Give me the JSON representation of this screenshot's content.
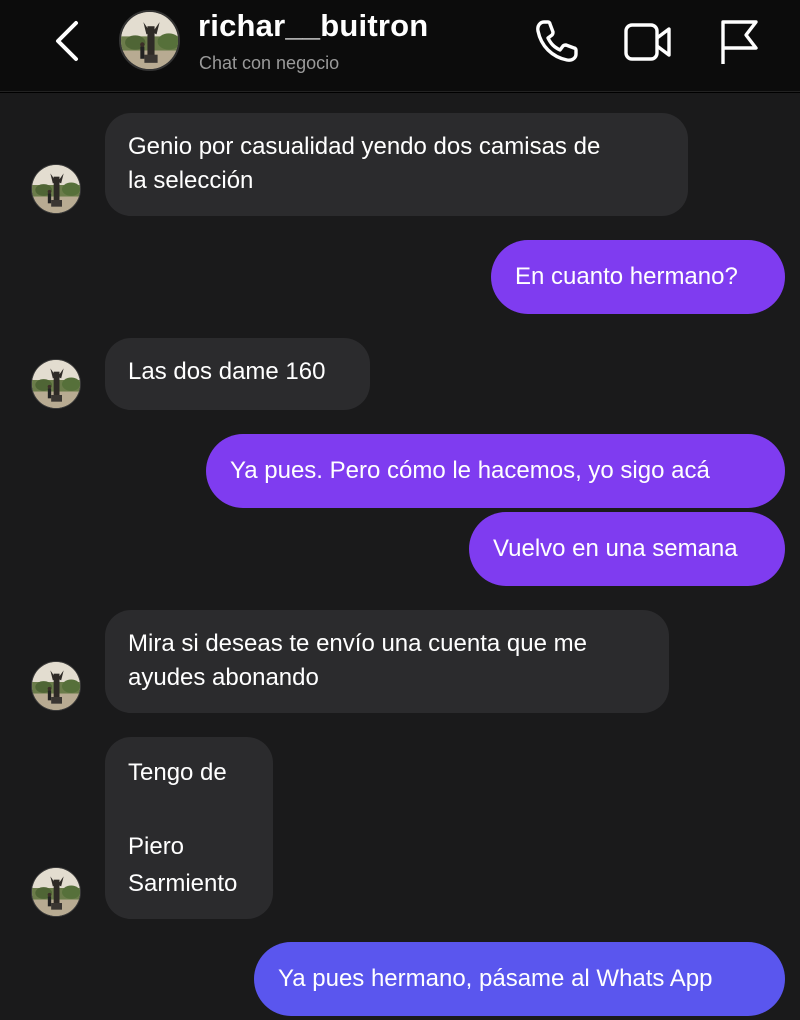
{
  "header": {
    "username": "richar__buitron",
    "subtitle": "Chat con negocio",
    "icons": [
      "back-icon",
      "phone-icon",
      "video-icon",
      "flag-icon"
    ]
  },
  "messages": [
    {
      "sender": "contact",
      "text": "Genio por casualidad yendo dos camisas de\nla selección"
    },
    {
      "sender": "me",
      "text": "En cuanto hermano?"
    },
    {
      "sender": "contact",
      "text": "Las dos dame 160"
    },
    {
      "sender": "me",
      "text": "Ya pues. Pero cómo le hacemos, yo sigo acá"
    },
    {
      "sender": "me",
      "text": "Vuelvo en una semana"
    },
    {
      "sender": "contact",
      "text": "Mira si deseas te envío una cuenta que me\nayudes abonando"
    },
    {
      "sender": "contact",
      "text": "Tengo de\n\nPiero\nSarmiento"
    },
    {
      "sender": "me",
      "text": "Ya pues hermano, pásame al Whats App"
    }
  ],
  "colors": {
    "outgoing_bubble": "#7f3cf0",
    "outgoing_bubble_last": "#5a56ee",
    "incoming_bubble": "#2b2b2d",
    "chat_background": "#1a1a1b"
  }
}
